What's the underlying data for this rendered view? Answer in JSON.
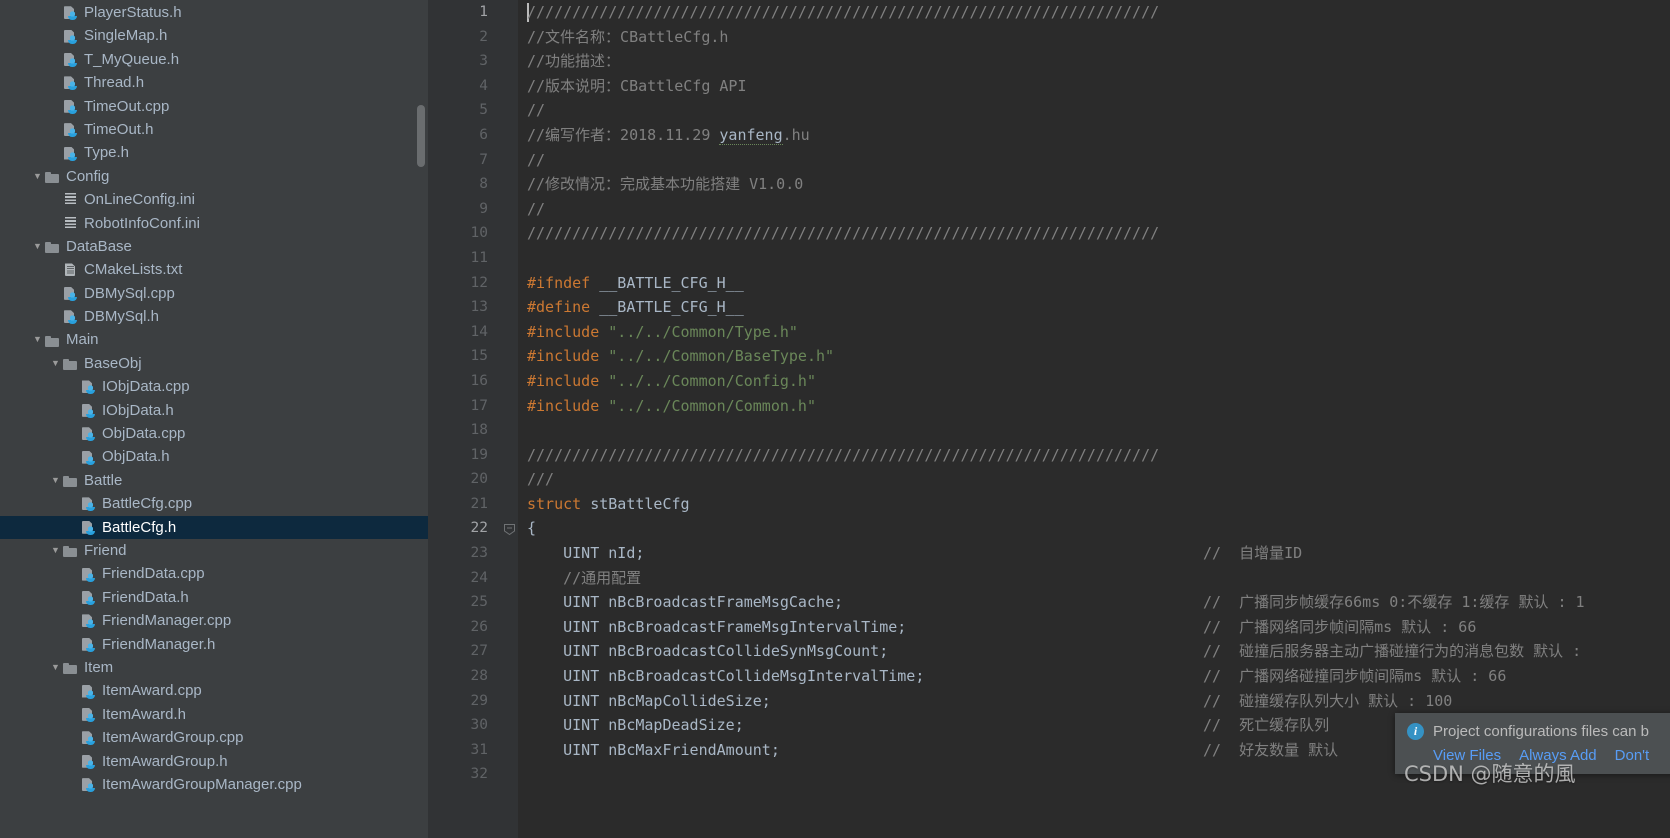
{
  "project_tree": {
    "scrollbar_visible": true,
    "selected_file": "BattleCfg.h",
    "items": [
      {
        "label": "PlayerStatus.h",
        "icon": "cpp-file-icon",
        "depth": 2,
        "type": "file",
        "expanded": null
      },
      {
        "label": "SingleMap.h",
        "icon": "cpp-file-icon",
        "depth": 2,
        "type": "file",
        "expanded": null
      },
      {
        "label": "T_MyQueue.h",
        "icon": "cpp-file-icon",
        "depth": 2,
        "type": "file",
        "expanded": null
      },
      {
        "label": "Thread.h",
        "icon": "cpp-file-icon",
        "depth": 2,
        "type": "file",
        "expanded": null
      },
      {
        "label": "TimeOut.cpp",
        "icon": "cpp-file-icon",
        "depth": 2,
        "type": "file",
        "expanded": null
      },
      {
        "label": "TimeOut.h",
        "icon": "cpp-file-icon",
        "depth": 2,
        "type": "file",
        "expanded": null
      },
      {
        "label": "Type.h",
        "icon": "cpp-file-icon",
        "depth": 2,
        "type": "file",
        "expanded": null
      },
      {
        "label": "Config",
        "icon": "folder-icon",
        "depth": 1,
        "type": "folder",
        "expanded": true
      },
      {
        "label": "OnLineConfig.ini",
        "icon": "ini-file-icon",
        "depth": 2,
        "type": "file",
        "expanded": null
      },
      {
        "label": "RobotInfoConf.ini",
        "icon": "ini-file-icon",
        "depth": 2,
        "type": "file",
        "expanded": null
      },
      {
        "label": "DataBase",
        "icon": "folder-icon",
        "depth": 1,
        "type": "folder",
        "expanded": true
      },
      {
        "label": "CMakeLists.txt",
        "icon": "txt-file-icon",
        "depth": 2,
        "type": "file",
        "expanded": null
      },
      {
        "label": "DBMySql.cpp",
        "icon": "cpp-file-icon",
        "depth": 2,
        "type": "file",
        "expanded": null
      },
      {
        "label": "DBMySql.h",
        "icon": "cpp-file-icon",
        "depth": 2,
        "type": "file",
        "expanded": null
      },
      {
        "label": "Main",
        "icon": "folder-icon",
        "depth": 1,
        "type": "folder",
        "expanded": true
      },
      {
        "label": "BaseObj",
        "icon": "folder-icon",
        "depth": 2,
        "type": "folder",
        "expanded": true
      },
      {
        "label": "IObjData.cpp",
        "icon": "cpp-file-icon",
        "depth": 3,
        "type": "file",
        "expanded": null
      },
      {
        "label": "IObjData.h",
        "icon": "cpp-file-icon",
        "depth": 3,
        "type": "file",
        "expanded": null
      },
      {
        "label": "ObjData.cpp",
        "icon": "cpp-file-icon",
        "depth": 3,
        "type": "file",
        "expanded": null
      },
      {
        "label": "ObjData.h",
        "icon": "cpp-file-icon",
        "depth": 3,
        "type": "file",
        "expanded": null
      },
      {
        "label": "Battle",
        "icon": "folder-icon",
        "depth": 2,
        "type": "folder",
        "expanded": true
      },
      {
        "label": "BattleCfg.cpp",
        "icon": "cpp-file-icon",
        "depth": 3,
        "type": "file",
        "expanded": null
      },
      {
        "label": "BattleCfg.h",
        "icon": "cpp-file-icon",
        "depth": 3,
        "type": "file",
        "expanded": null,
        "selected": true
      },
      {
        "label": "Friend",
        "icon": "folder-icon",
        "depth": 2,
        "type": "folder",
        "expanded": true
      },
      {
        "label": "FriendData.cpp",
        "icon": "cpp-file-icon",
        "depth": 3,
        "type": "file",
        "expanded": null
      },
      {
        "label": "FriendData.h",
        "icon": "cpp-file-icon",
        "depth": 3,
        "type": "file",
        "expanded": null
      },
      {
        "label": "FriendManager.cpp",
        "icon": "cpp-file-icon",
        "depth": 3,
        "type": "file",
        "expanded": null
      },
      {
        "label": "FriendManager.h",
        "icon": "cpp-file-icon",
        "depth": 3,
        "type": "file",
        "expanded": null
      },
      {
        "label": "Item",
        "icon": "folder-icon",
        "depth": 2,
        "type": "folder",
        "expanded": true
      },
      {
        "label": "ItemAward.cpp",
        "icon": "cpp-file-icon",
        "depth": 3,
        "type": "file",
        "expanded": null
      },
      {
        "label": "ItemAward.h",
        "icon": "cpp-file-icon",
        "depth": 3,
        "type": "file",
        "expanded": null
      },
      {
        "label": "ItemAwardGroup.cpp",
        "icon": "cpp-file-icon",
        "depth": 3,
        "type": "file",
        "expanded": null
      },
      {
        "label": "ItemAwardGroup.h",
        "icon": "cpp-file-icon",
        "depth": 3,
        "type": "file",
        "expanded": null
      },
      {
        "label": "ItemAwardGroupManager.cpp",
        "icon": "cpp-file-icon",
        "depth": 3,
        "type": "file",
        "expanded": null
      }
    ]
  },
  "editor": {
    "current_line": 22,
    "fold_marker_line": 22,
    "caret_line": 1,
    "line_numbers": [
      1,
      2,
      3,
      4,
      5,
      6,
      7,
      8,
      9,
      10,
      11,
      12,
      13,
      14,
      15,
      16,
      17,
      18,
      19,
      20,
      21,
      22,
      23,
      24,
      25,
      26,
      27,
      28,
      29,
      30,
      31,
      32
    ],
    "lines": [
      {
        "n": 1,
        "segments": [
          {
            "t": "comment",
            "s": "//////////////////////////////////////////////////////////////////////"
          }
        ]
      },
      {
        "n": 2,
        "segments": [
          {
            "t": "comment",
            "s": "//文件名称：CBattleCfg.h"
          }
        ]
      },
      {
        "n": 3,
        "segments": [
          {
            "t": "comment",
            "s": "//功能描述："
          }
        ]
      },
      {
        "n": 4,
        "segments": [
          {
            "t": "comment",
            "s": "//版本说明：CBattleCfg API"
          }
        ]
      },
      {
        "n": 5,
        "segments": [
          {
            "t": "comment",
            "s": "//"
          }
        ]
      },
      {
        "n": 6,
        "segments": [
          {
            "t": "comment",
            "s": "//编写作者：2018.11.29 "
          },
          {
            "t": "typo",
            "s": "yanfeng"
          },
          {
            "t": "comment",
            "s": ".hu"
          }
        ]
      },
      {
        "n": 7,
        "segments": [
          {
            "t": "comment",
            "s": "//"
          }
        ]
      },
      {
        "n": 8,
        "segments": [
          {
            "t": "comment",
            "s": "//修改情况：完成基本功能搭建 V1.0.0"
          }
        ]
      },
      {
        "n": 9,
        "segments": [
          {
            "t": "comment",
            "s": "//"
          }
        ]
      },
      {
        "n": 10,
        "segments": [
          {
            "t": "comment",
            "s": "//////////////////////////////////////////////////////////////////////"
          }
        ]
      },
      {
        "n": 11,
        "segments": []
      },
      {
        "n": 12,
        "segments": [
          {
            "t": "pre",
            "s": "#ifndef"
          },
          {
            "t": "plain",
            "s": " __BATTLE_CFG_H__"
          }
        ]
      },
      {
        "n": 13,
        "segments": [
          {
            "t": "pre",
            "s": "#define"
          },
          {
            "t": "plain",
            "s": " __BATTLE_CFG_H__"
          }
        ]
      },
      {
        "n": 14,
        "segments": [
          {
            "t": "pre",
            "s": "#include"
          },
          {
            "t": "str",
            "s": " \"../../Common/Type.h\""
          }
        ]
      },
      {
        "n": 15,
        "segments": [
          {
            "t": "pre",
            "s": "#include"
          },
          {
            "t": "str",
            "s": " \"../../Common/BaseType.h\""
          }
        ]
      },
      {
        "n": 16,
        "segments": [
          {
            "t": "pre",
            "s": "#include"
          },
          {
            "t": "str",
            "s": " \"../../Common/Config.h\""
          }
        ]
      },
      {
        "n": 17,
        "segments": [
          {
            "t": "pre",
            "s": "#include"
          },
          {
            "t": "str",
            "s": " \"../../Common/Common.h\""
          }
        ]
      },
      {
        "n": 18,
        "segments": []
      },
      {
        "n": 19,
        "segments": [
          {
            "t": "comment",
            "s": "//////////////////////////////////////////////////////////////////////"
          }
        ]
      },
      {
        "n": 20,
        "segments": [
          {
            "t": "comment",
            "s": "///"
          }
        ]
      },
      {
        "n": 21,
        "segments": [
          {
            "t": "kw",
            "s": "struct"
          },
          {
            "t": "plain",
            "s": " stBattleCfg"
          }
        ]
      },
      {
        "n": 22,
        "segments": [
          {
            "t": "plain",
            "s": "{"
          }
        ]
      },
      {
        "n": 23,
        "segments": [
          {
            "t": "plain",
            "s": "    UINT nId;"
          }
        ],
        "comment": "//  自增量ID"
      },
      {
        "n": 24,
        "segments": [
          {
            "t": "comment",
            "s": "    //通用配置"
          }
        ]
      },
      {
        "n": 25,
        "segments": [
          {
            "t": "plain",
            "s": "    UINT nBcBroadcastFrameMsgCache;"
          }
        ],
        "comment": "//  广播同步帧缓存66ms 0:不缓存 1:缓存 默认 : 1"
      },
      {
        "n": 26,
        "segments": [
          {
            "t": "plain",
            "s": "    UINT nBcBroadcastFrameMsgIntervalTime;"
          }
        ],
        "comment": "//  广播网络同步帧间隔ms 默认 : 66"
      },
      {
        "n": 27,
        "segments": [
          {
            "t": "plain",
            "s": "    UINT nBcBroadcastCollideSynMsgCount;"
          }
        ],
        "comment": "//  碰撞后服务器主动广播碰撞行为的消息包数 默认 :"
      },
      {
        "n": 28,
        "segments": [
          {
            "t": "plain",
            "s": "    UINT nBcBroadcastCollideMsgIntervalTime;"
          }
        ],
        "comment": "//  广播网络碰撞同步帧间隔ms 默认 : 66"
      },
      {
        "n": 29,
        "segments": [
          {
            "t": "plain",
            "s": "    UINT nBcMapCollideSize;"
          }
        ],
        "comment": "//  碰撞缓存队列大小 默认 : 100"
      },
      {
        "n": 30,
        "segments": [
          {
            "t": "plain",
            "s": "    UINT nBcMapDeadSize;"
          }
        ],
        "comment": "//  死亡缓存队列"
      },
      {
        "n": 31,
        "segments": [
          {
            "t": "plain",
            "s": "    UINT nBcMaxFriendAmount;"
          }
        ],
        "comment": "//  好友数量 默认"
      },
      {
        "n": 32,
        "segments": []
      }
    ]
  },
  "notification": {
    "icon": "info-icon",
    "message": "Project configurations files can b",
    "actions": [
      {
        "label": "View Files"
      },
      {
        "label": "Always Add"
      },
      {
        "label": "Don't"
      }
    ]
  },
  "watermark": {
    "text": "CSDN @随意的風"
  },
  "colors": {
    "tree_background": "#3c3f41",
    "tree_selected": "#0d293e",
    "editor_background": "#2b2b2b",
    "gutter_background": "#313335",
    "text_default": "#a9b7c6",
    "comment": "#808080",
    "preprocessor": "#cc7832",
    "keyword": "#cc7832",
    "string": "#6a8759",
    "line_number": "#606366",
    "notification_background": "#4c5052",
    "link": "#589df6",
    "info_icon": "#3592c4"
  }
}
